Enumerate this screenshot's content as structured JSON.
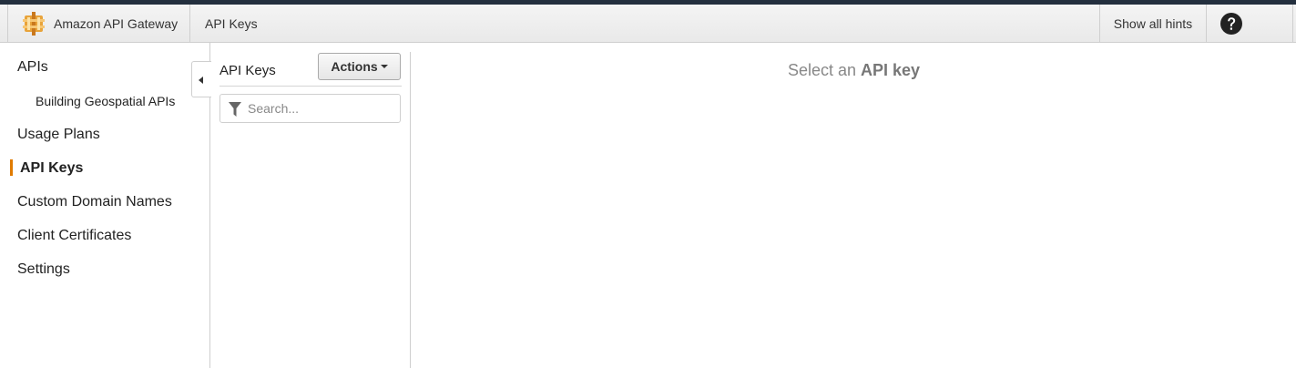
{
  "header": {
    "brand_logo": "aws-api-gateway-logo",
    "brand_label": "Amazon API Gateway",
    "breadcrumb": "API Keys",
    "hints_label": "Show all hints",
    "help_icon": "question-circle-icon"
  },
  "sidebar": {
    "items": [
      {
        "label": "APIs"
      },
      {
        "label": "Building Geospatial APIs"
      },
      {
        "label": "Usage Plans"
      },
      {
        "label": "API Keys"
      },
      {
        "label": "Custom Domain Names"
      },
      {
        "label": "Client Certificates"
      },
      {
        "label": "Settings"
      }
    ],
    "active_index": 3,
    "active_color": "#e07b00"
  },
  "list": {
    "title": "API Keys",
    "actions_label": "Actions",
    "search": {
      "placeholder": "Search...",
      "value": ""
    },
    "filter_icon": "filter-icon"
  },
  "main": {
    "message_prefix": "Select an",
    "message_bold": "API key"
  }
}
